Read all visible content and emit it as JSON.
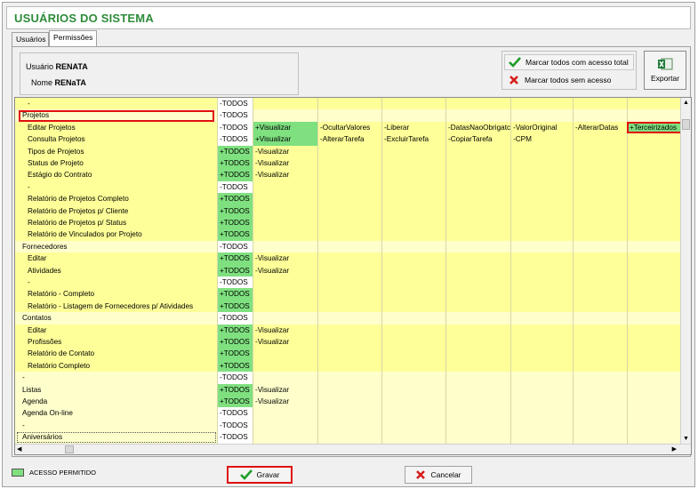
{
  "window": {
    "title": "USUÁRIOS DO SISTEMA"
  },
  "tabs": [
    {
      "label": "Usuários"
    },
    {
      "label": "Permissões"
    }
  ],
  "user": {
    "usuario_label": "Usuário",
    "usuario_value": "RENATA",
    "nome_label": "Nome",
    "nome_value": "RENaTA"
  },
  "actions": {
    "mark_all": "Marcar todos com acesso total",
    "unmark_all": "Marcar todos sem acesso",
    "export": "Exportar"
  },
  "rows": [
    {
      "name": "-",
      "todos": "-TODOS",
      "todos_green": false,
      "perms": []
    },
    {
      "name": "Projetos",
      "todos": "-TODOS",
      "todos_green": false,
      "group": true,
      "perms": []
    },
    {
      "name": "Editar Projetos",
      "todos": "-TODOS",
      "todos_green": false,
      "perms": [
        "+Visualizar",
        "-OcultarValores",
        "-Liberar",
        "-DatasNaoObrigatc",
        "-ValorOriginal",
        "-AlterarDatas",
        "+Terceirizados"
      ]
    },
    {
      "name": "Consulta Projetos",
      "todos": "-TODOS",
      "todos_green": false,
      "perms": [
        "+Visualizar",
        "-AlterarTarefa",
        "-ExcluirTarefa",
        "-CopiarTarefa",
        "-CPM"
      ]
    },
    {
      "name": "Tipos de Projetos",
      "todos": "+TODOS",
      "todos_green": true,
      "perms": [
        "-Visualizar"
      ]
    },
    {
      "name": "Status de Projeto",
      "todos": "+TODOS",
      "todos_green": true,
      "perms": [
        "-Visualizar"
      ]
    },
    {
      "name": "Estágio do Contrato",
      "todos": "+TODOS",
      "todos_green": true,
      "perms": [
        "-Visualizar"
      ]
    },
    {
      "name": "-",
      "todos": "-TODOS",
      "todos_green": false,
      "perms": []
    },
    {
      "name": "Relatório de Projetos Completo",
      "todos": "+TODOS",
      "todos_green": true,
      "perms": []
    },
    {
      "name": "Relatório de Projetos p/ Cliente",
      "todos": "+TODOS",
      "todos_green": true,
      "perms": []
    },
    {
      "name": "Relatório de Projetos p/ Status",
      "todos": "+TODOS",
      "todos_green": true,
      "perms": []
    },
    {
      "name": "Relatório de Vinculados por Projeto",
      "todos": "+TODOS",
      "todos_green": true,
      "perms": []
    },
    {
      "name": "Fornecedores",
      "todos": "-TODOS",
      "todos_green": false,
      "group": true,
      "perms": []
    },
    {
      "name": "Editar",
      "todos": "+TODOS",
      "todos_green": true,
      "perms": [
        "-Visualizar"
      ]
    },
    {
      "name": "Atividades",
      "todos": "+TODOS",
      "todos_green": true,
      "perms": [
        "-Visualizar"
      ]
    },
    {
      "name": "-",
      "todos": "-TODOS",
      "todos_green": false,
      "perms": []
    },
    {
      "name": "Relatório - Completo",
      "todos": "+TODOS",
      "todos_green": true,
      "perms": []
    },
    {
      "name": "Relatório - Listagem de Fornecedores p/ Atividades",
      "todos": "+TODOS",
      "todos_green": true,
      "perms": []
    },
    {
      "name": "Contatos",
      "todos": "-TODOS",
      "todos_green": false,
      "group": true,
      "perms": []
    },
    {
      "name": "Editar",
      "todos": "+TODOS",
      "todos_green": true,
      "perms": [
        "-Visualizar"
      ]
    },
    {
      "name": "Profissões",
      "todos": "+TODOS",
      "todos_green": true,
      "perms": [
        "-Visualizar"
      ]
    },
    {
      "name": "Relatório de Contato",
      "todos": "+TODOS",
      "todos_green": true,
      "perms": []
    },
    {
      "name": "Relatório Completo",
      "todos": "+TODOS",
      "todos_green": true,
      "perms": []
    },
    {
      "name": "-",
      "todos": "-TODOS",
      "todos_green": false,
      "group": true,
      "perms": []
    },
    {
      "name": "Listas",
      "todos": "+TODOS",
      "todos_green": true,
      "group": true,
      "perms": [
        "-Visualizar"
      ]
    },
    {
      "name": "Agenda",
      "todos": "+TODOS",
      "todos_green": true,
      "group": true,
      "perms": [
        "-Visualizar"
      ]
    },
    {
      "name": "Agenda On-line",
      "todos": "-TODOS",
      "todos_green": false,
      "group": true,
      "perms": []
    },
    {
      "name": "-",
      "todos": "-TODOS",
      "todos_green": false,
      "group": true,
      "perms": []
    },
    {
      "name": "Aniversários",
      "todos": "-TODOS",
      "todos_green": false,
      "group": true,
      "perms": []
    }
  ],
  "legend": {
    "label": "ACESSO PERMITIDO"
  },
  "buttons": {
    "save": "Gravar",
    "cancel": "Cancelar"
  },
  "colors": {
    "title": "#2e8b3a",
    "allowed": "#7fe07f",
    "row_yellow": "#ffff99",
    "highlight": "#e01010"
  }
}
